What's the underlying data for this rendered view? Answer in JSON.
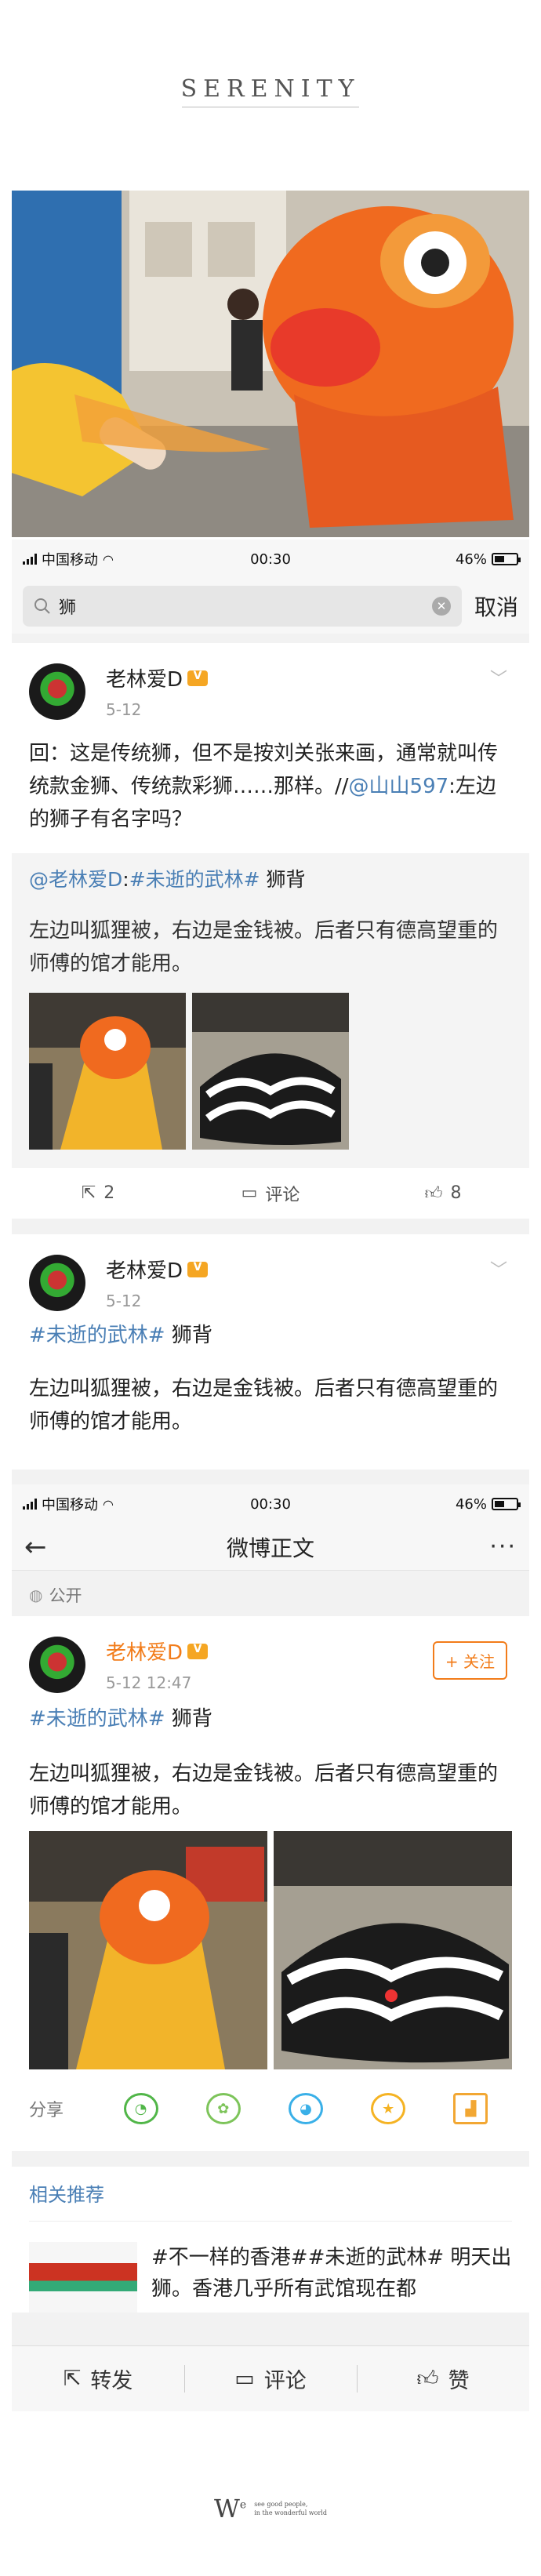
{
  "brand": {
    "title": "SERENITY"
  },
  "screen1": {
    "status": {
      "carrier": "中国移动",
      "time": "00:30",
      "battery": "46%"
    },
    "search": {
      "query": "狮",
      "cancel": "取消"
    },
    "post": {
      "author": "老林爱D",
      "time": "5-12",
      "text_before": "回：这是传统狮，但不是按刘关张来画，通常就叫传统款金狮、传统款彩狮……那样。//",
      "mention": "@山山597",
      "text_after": ":左边的狮子有名字吗？",
      "retweet": {
        "author": "@老林爱D",
        "colon": ":",
        "hashtag": "#未逝的武林#",
        "title": " 狮背",
        "text": "左边叫狐狸被，右边是金钱被。后者只有德高望重的师傅的馆才能用。"
      },
      "actions": {
        "repost": "2",
        "comment": "评论",
        "like": "8"
      }
    },
    "post2": {
      "author": "老林爱D",
      "time": "5-12",
      "hashtag": "#未逝的武林#",
      "title": " 狮背",
      "text": "左边叫狐狸被，右边是金钱被。后者只有德高望重的师傅的馆才能用。"
    }
  },
  "screen2": {
    "status": {
      "carrier": "中国移动",
      "time": "00:30",
      "battery": "46%"
    },
    "nav": {
      "title": "微博正文"
    },
    "visibility": "公开",
    "post": {
      "author": "老林爱D",
      "time": "5-12 12:47",
      "follow": "+ 关注",
      "hashtag": "#未逝的武林#",
      "title": " 狮背",
      "text": "左边叫狐狸被，右边是金钱被。后者只有德高望重的师傅的馆才能用。"
    },
    "share": {
      "label": "分享"
    },
    "related": {
      "title": "相关推荐",
      "item_text": "#不一样的香港##未逝的武林# 明天出狮。香港几乎所有武馆现在都"
    },
    "bottom": {
      "repost": "转发",
      "comment": "评论",
      "like": "赞"
    }
  },
  "signature": {
    "mark": "W",
    "sup": "e",
    "line1": "see good people,",
    "line2": "in the wonderful world"
  },
  "colors": {
    "link": "#4a7fb5",
    "accent": "#f27c1a",
    "badge": "#f5a623"
  },
  "icons": [
    "search-icon",
    "clear-icon",
    "chevron-down-icon",
    "repost-icon",
    "comment-icon",
    "like-icon",
    "back-icon",
    "more-icon",
    "globe-icon",
    "wechat-icon",
    "moments-icon",
    "qq-icon",
    "favorite-icon",
    "image-icon"
  ]
}
